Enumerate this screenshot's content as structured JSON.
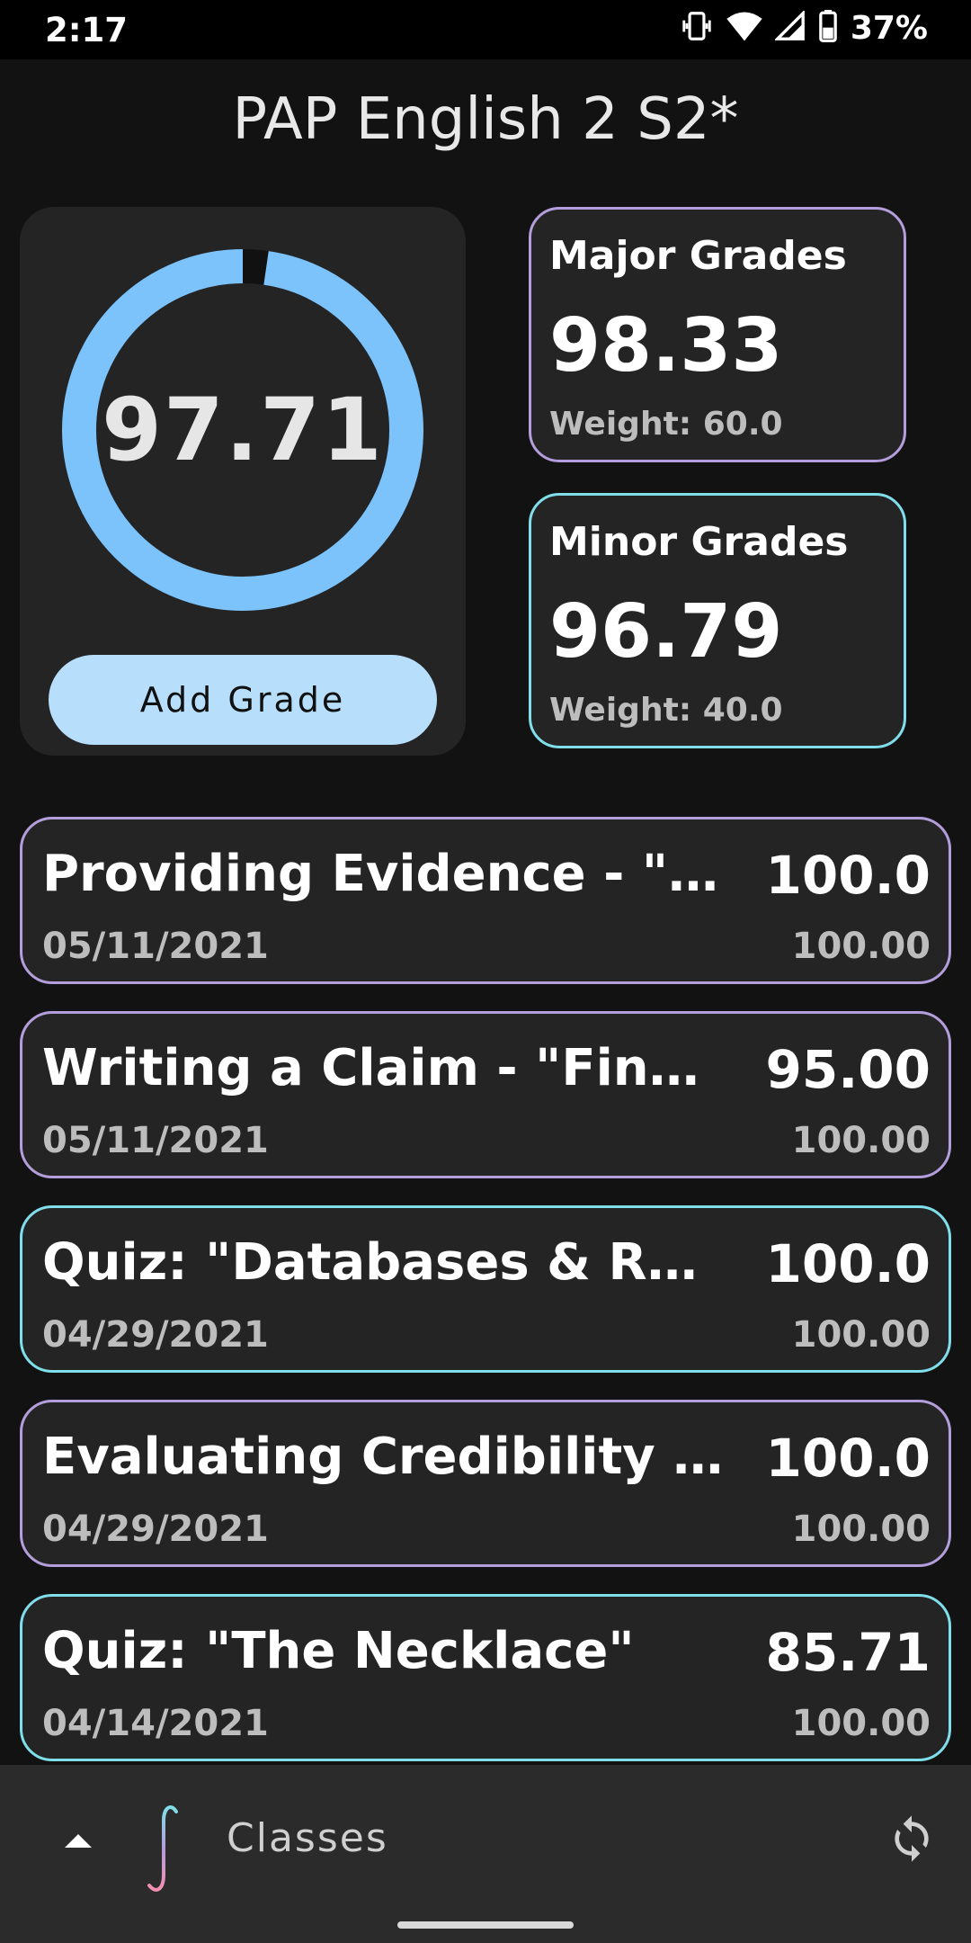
{
  "status": {
    "time": "2:17",
    "battery": "37%"
  },
  "title": "PAP English 2 S2*",
  "overall": {
    "value": "97.71",
    "percent": 97.71,
    "ring_color": "#7cc3fb",
    "add_button": "Add Grade"
  },
  "categories": [
    {
      "title": "Major Grades",
      "value": "98.33",
      "weight": "Weight: 60.0",
      "accent": "#b39ddb"
    },
    {
      "title": "Minor Grades",
      "value": "96.79",
      "weight": "Weight: 40.0",
      "accent": "#80deea"
    }
  ],
  "grades": [
    {
      "name": "Providing Evidence - \"F…",
      "date": "05/11/2021",
      "score": "100.0",
      "max": "100.00",
      "category": "major"
    },
    {
      "name": "Writing a Claim - \"Fina…",
      "date": "05/11/2021",
      "score": "95.00",
      "max": "100.00",
      "category": "major"
    },
    {
      "name": "Quiz: \"Databases & Res…",
      "date": "04/29/2021",
      "score": "100.0",
      "max": "100.00",
      "category": "minor"
    },
    {
      "name": "Evaluating Credibility …",
      "date": "04/29/2021",
      "score": "100.0",
      "max": "100.00",
      "category": "major"
    },
    {
      "name": "Quiz: \"The Necklace\"",
      "date": "04/14/2021",
      "score": "85.71",
      "max": "100.00",
      "category": "minor"
    }
  ],
  "bottom_bar": {
    "label": "Classes",
    "up_icon": "chevron-up-icon",
    "logo_icon": "integral-logo-icon",
    "refresh_icon": "refresh-icon"
  }
}
